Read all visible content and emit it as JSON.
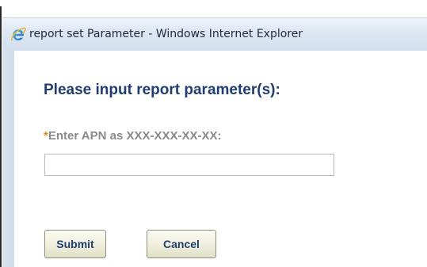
{
  "window": {
    "title": "report set Parameter - Windows Internet Explorer",
    "icon": "internet-explorer-icon"
  },
  "form": {
    "heading": "Please input report parameter(s):",
    "required_marker": "*",
    "apn_label": "Enter APN as XXX-XXX-XX-XX:",
    "apn_value": "",
    "apn_placeholder": ""
  },
  "buttons": {
    "submit_label": "Submit",
    "cancel_label": "Cancel"
  },
  "colors": {
    "heading": "#1f3d6e",
    "label": "#8a8a8a",
    "required": "#d98a1e"
  }
}
